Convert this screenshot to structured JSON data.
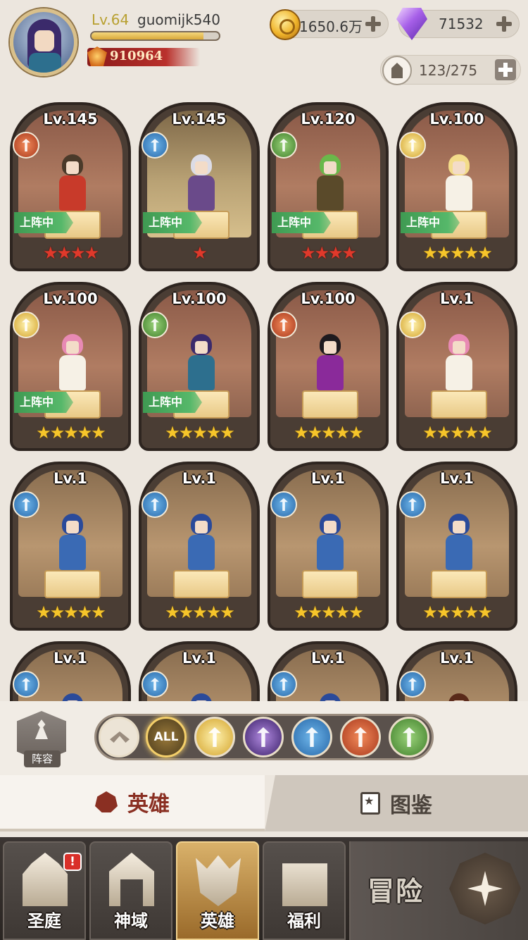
{
  "player": {
    "level_label": "Lv.64",
    "name": "guomijk540",
    "exp_fraction": 0.88,
    "combat_power": "910964"
  },
  "resources": {
    "gold": "1650.6万",
    "gems": "71532"
  },
  "hero_capacity": "123/275",
  "heroes": [
    {
      "level": "Lv.145",
      "faction": "wolf",
      "in_team": true,
      "stars": "★★★★",
      "star_color": "red",
      "bg": "red",
      "palette": [
        "#4a3a2a",
        "#c83a2a"
      ]
    },
    {
      "level": "Lv.145",
      "faction": "knight",
      "in_team": true,
      "stars": "★",
      "star_color": "red",
      "bg": "gold",
      "palette": [
        "#dcdce6",
        "#6a4a8a"
      ]
    },
    {
      "level": "Lv.120",
      "faction": "tree",
      "in_team": true,
      "stars": "★★★★",
      "star_color": "red",
      "bg": "red",
      "palette": [
        "#6ab84a",
        "#5a4a2a"
      ]
    },
    {
      "level": "Lv.100",
      "faction": "light",
      "in_team": true,
      "stars": "★★★★★",
      "star_color": "gold",
      "bg": "red",
      "palette": [
        "#f3dc8a",
        "#f6f1e6"
      ]
    },
    {
      "level": "Lv.100",
      "faction": "light",
      "in_team": true,
      "stars": "★★★★★",
      "star_color": "gold",
      "bg": "red",
      "palette": [
        "#e88ab4",
        "#f6f1e6"
      ]
    },
    {
      "level": "Lv.100",
      "faction": "tree",
      "in_team": true,
      "stars": "★★★★★",
      "star_color": "gold",
      "bg": "red",
      "palette": [
        "#3b2a6b",
        "#2d6f8e"
      ]
    },
    {
      "level": "Lv.100",
      "faction": "wolf",
      "in_team": false,
      "stars": "★★★★★",
      "star_color": "gold",
      "bg": "red",
      "palette": [
        "#1e1a1e",
        "#8a2a9a"
      ]
    },
    {
      "level": "Lv.1",
      "faction": "light",
      "in_team": false,
      "stars": "★★★★★",
      "star_color": "gold",
      "bg": "red",
      "palette": [
        "#e88ab4",
        "#f6f1e6"
      ]
    },
    {
      "level": "Lv.1",
      "faction": "knight",
      "in_team": false,
      "stars": "★★★★★",
      "star_color": "gold",
      "bg": "plain",
      "palette": [
        "#2a4a9a",
        "#3a6ab4"
      ]
    },
    {
      "level": "Lv.1",
      "faction": "knight",
      "in_team": false,
      "stars": "★★★★★",
      "star_color": "gold",
      "bg": "plain",
      "palette": [
        "#2a4a9a",
        "#3a6ab4"
      ]
    },
    {
      "level": "Lv.1",
      "faction": "knight",
      "in_team": false,
      "stars": "★★★★★",
      "star_color": "gold",
      "bg": "plain",
      "palette": [
        "#2a4a9a",
        "#3a6ab4"
      ]
    },
    {
      "level": "Lv.1",
      "faction": "knight",
      "in_team": false,
      "stars": "★★★★★",
      "star_color": "gold",
      "bg": "plain",
      "palette": [
        "#2a4a9a",
        "#3a6ab4"
      ]
    },
    {
      "level": "Lv.1",
      "faction": "knight",
      "in_team": false,
      "stars": "",
      "star_color": "gold",
      "bg": "plain",
      "palette": [
        "#2a4a9a",
        "#3a6ab4"
      ]
    },
    {
      "level": "Lv.1",
      "faction": "knight",
      "in_team": false,
      "stars": "",
      "star_color": "gold",
      "bg": "plain",
      "palette": [
        "#2a4a9a",
        "#3a6ab4"
      ]
    },
    {
      "level": "Lv.1",
      "faction": "knight",
      "in_team": false,
      "stars": "",
      "star_color": "gold",
      "bg": "plain",
      "palette": [
        "#2a4a9a",
        "#3a6ab4"
      ]
    },
    {
      "level": "Lv.1",
      "faction": "knight",
      "in_team": false,
      "stars": "",
      "star_color": "gold",
      "bg": "plain",
      "palette": [
        "#5a2a1a",
        "#a83a2a"
      ]
    }
  ],
  "in_team_label": "上阵中",
  "lineup_label": "阵容",
  "filters": {
    "all_label": "ALL",
    "items": [
      "sort",
      "all",
      "light",
      "dark",
      "knight",
      "wolf",
      "tree"
    ]
  },
  "tabs": {
    "heroes": "英雄",
    "codex": "图鉴"
  },
  "nav": {
    "court": "圣庭",
    "court_badge": "!",
    "domain": "神域",
    "heroes": "英雄",
    "welfare": "福利",
    "adventure": "冒险"
  },
  "colors": {
    "in_team_green": "#4caf62",
    "star_red": "#e0392b",
    "star_gold": "#f6c52a",
    "accent_gold": "#f4cf6a"
  }
}
